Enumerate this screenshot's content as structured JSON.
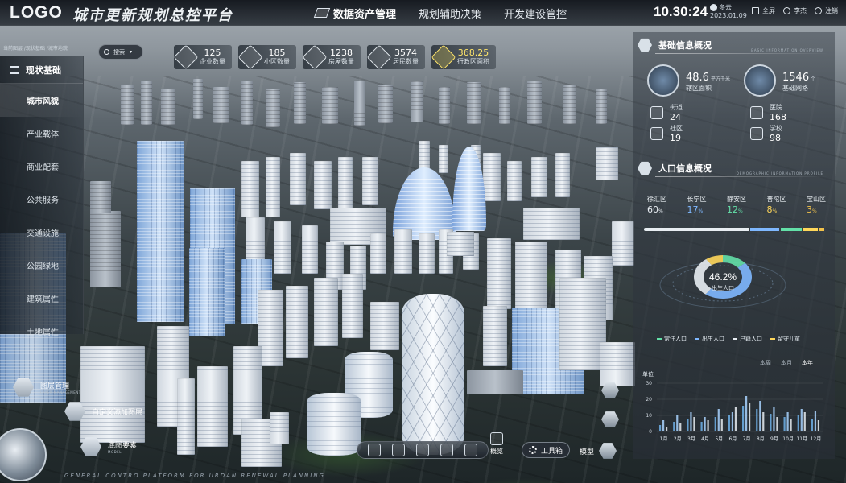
{
  "header": {
    "logo": "LOGO",
    "title": "城市更新规划总控平台",
    "nav": [
      "数据资产管理",
      "规划辅助决策",
      "开发建设管控"
    ],
    "time": "10.30:24",
    "weather": "多云",
    "date": "2023.01.09",
    "buttons": [
      "全屏",
      "李杰",
      "注销"
    ]
  },
  "breadcrumb": "当前图层 /现状基础 /城市地貌",
  "left_nav": {
    "head": "现状基础",
    "items": [
      "城市风貌",
      "产业载体",
      "商业配套",
      "公共服务",
      "交通设施",
      "公园绿地",
      "建筑属性",
      "土地属性"
    ]
  },
  "search": {
    "label": "搜索"
  },
  "stats": [
    {
      "value": "125",
      "label": "企业数量"
    },
    {
      "value": "185",
      "label": "小区数量"
    },
    {
      "value": "1238",
      "label": "房屋数量"
    },
    {
      "value": "3574",
      "label": "居民数量"
    },
    {
      "value": "368.25",
      "label": "行政区面积"
    }
  ],
  "basic_info": {
    "title": "基础信息概况",
    "subtitle": "BASIC INFORMATION OVERVIEW",
    "area_value": "48.6",
    "area_unit": "平方千米",
    "area_label": "辖区面积",
    "grid_value": "1546",
    "grid_unit": "个",
    "grid_label": "基础网格",
    "items": [
      {
        "label": "街道",
        "value": "24"
      },
      {
        "label": "医院",
        "value": "168"
      },
      {
        "label": "社区",
        "value": "19"
      },
      {
        "label": "学校",
        "value": "98"
      }
    ]
  },
  "population": {
    "title": "人口信息概况",
    "subtitle": "DEMOGRAPHIC INFORMATION PROFILE",
    "districts": [
      {
        "name": "徐汇区",
        "value": "60",
        "color": "#e8edf2"
      },
      {
        "name": "长宁区",
        "value": "17",
        "color": "#7fb8ff"
      },
      {
        "name": "静安区",
        "value": "12",
        "color": "#63e0a8"
      },
      {
        "name": "普陀区",
        "value": "8",
        "color": "#ffd75a"
      },
      {
        "name": "宝山区",
        "value": "3",
        "color": "#f2c24b"
      }
    ],
    "percent_unit": "%",
    "donut_value": "46.2%",
    "donut_label": "出生人口",
    "legend": [
      "常住人口",
      "出生人口",
      "户籍人口",
      "留守儿童"
    ],
    "legend_colors": [
      "#63e0a8",
      "#7fb8ff",
      "#e8edf2",
      "#ffd75a"
    ],
    "donut_fractions": [
      0.14,
      0.462,
      0.3,
      0.098
    ],
    "period_tabs": [
      "本周",
      "本月",
      "本年"
    ],
    "active_period": "本年",
    "unit_label": "单位"
  },
  "chart_data": {
    "type": "bar",
    "categories": [
      "1月",
      "2月",
      "3月",
      "4月",
      "5月",
      "6月",
      "7月",
      "8月",
      "9月",
      "10月",
      "11月",
      "12月"
    ],
    "series": [
      {
        "values": [
          4,
          6,
          8,
          6,
          9,
          10,
          16,
          14,
          11,
          9,
          10,
          8
        ]
      },
      {
        "values": [
          7,
          10,
          12,
          9,
          14,
          12,
          22,
          19,
          15,
          12,
          14,
          13
        ]
      },
      {
        "values": [
          3,
          5,
          9,
          7,
          8,
          15,
          18,
          12,
          9,
          8,
          12,
          7
        ]
      }
    ],
    "ylim": [
      0,
      30
    ],
    "yticks": [
      "30",
      "20",
      "10",
      "0"
    ]
  },
  "left_bottom": [
    {
      "label": "图层管理",
      "sub": "LAYER MANAGEMENT"
    },
    {
      "label": "自定义添加图层",
      "sub": ""
    },
    {
      "label": "底图要素",
      "sub": "MODEL"
    }
  ],
  "toolbar": {
    "overview": "概览",
    "toolbox": "工具箱",
    "model": "模型"
  },
  "footer": "GENERAL CONTRO PLATFORM FOR URDAN RENEWAL PLANNING"
}
